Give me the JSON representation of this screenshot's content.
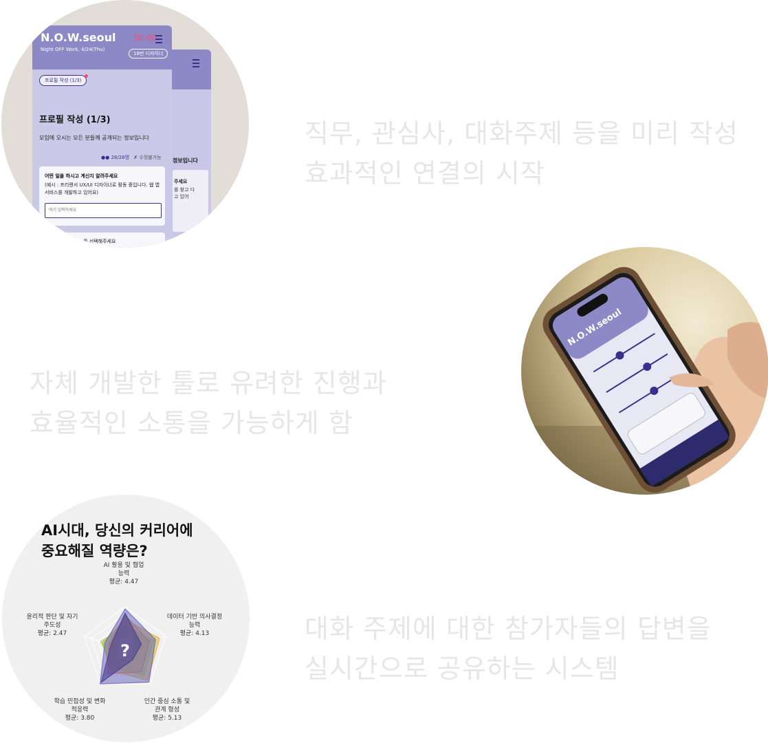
{
  "taglines": {
    "t1": [
      "직무, 관심사, 대화주제 등을 미리 작성",
      "효과적인 연결의 시작"
    ],
    "t2": [
      "자체 개발한 툴로 유려한 진행과",
      "효율적인 소통을 가능하게 함"
    ],
    "t3": [
      "대화 주제에 대한 참가자들의 답변을",
      "실시간으로 공유하는 시스템"
    ]
  },
  "app": {
    "logo": "N.O.W.seoul",
    "subtitle": "Night OFF Work, 4/24(Thu)",
    "timer": "00:00",
    "role_badge": "18번 디자이너",
    "step_pill": "프로필 작성 (1/3)",
    "page_title": "프로필 작성 (1/3)",
    "page_desc": "모임에 오시는 모든 분들께 공개되는 정보입니다",
    "participants": "28/28명",
    "editable": "수정불가능",
    "question": "어떤 일을 하시고 계신지 알려주세요",
    "example": "(예시 : 프리랜서 UX/UI 디자이너로 활동 중입니다. 웹 앱 서비스를 개발하고 있어요)",
    "input_placeholder": "여기 입력하세요",
    "next_question": "~ 를 선택해주세요",
    "back_partial": "정보입니다",
    "back_question_partial": "주세요",
    "back_example_partial": "를 찾고 다\n고 있어"
  },
  "radar": {
    "title": [
      "AI시대, 당신의 커리어에",
      "중요해질 역량은?"
    ],
    "axes": [
      {
        "label": [
          "AI 활용 및 협업",
          "능력"
        ],
        "avg": "평균: 4.47"
      },
      {
        "label": [
          "데이터 기반 의사결정",
          "능력"
        ],
        "avg": "평균: 4.13"
      },
      {
        "label": [
          "인간 중심 소통 및",
          "관계 형성"
        ],
        "avg": "평균: 5.13"
      },
      {
        "label": [
          "학습 민첩성 및 변화",
          "적응력"
        ],
        "avg": "평균: 3.80"
      },
      {
        "label": [
          "윤리적 판단 및 자기",
          "주도성"
        ],
        "avg": "평균: 2.47"
      }
    ],
    "center_mark": "?"
  },
  "colors": {
    "tagline": "#e6e6e6",
    "app_header": "#8c89c6",
    "app_body": "#c8c6e6",
    "accent": "#3b2f8c"
  }
}
